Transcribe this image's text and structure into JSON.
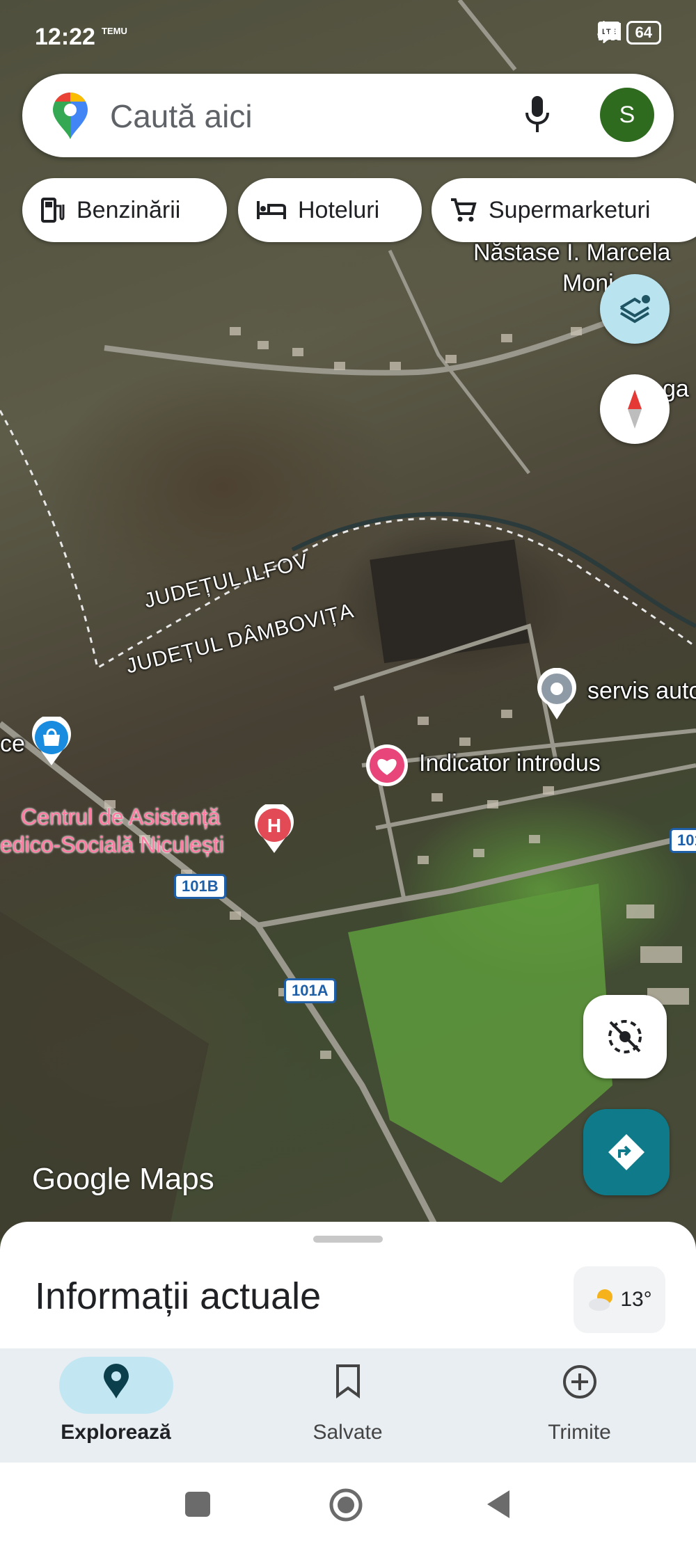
{
  "status_bar": {
    "time": "12:22",
    "carrier_badge": "TEMU",
    "network": "4G",
    "battery": "64"
  },
  "search": {
    "placeholder": "Caută aici",
    "avatar_initial": "S"
  },
  "chips": [
    {
      "label": "Benzinării",
      "icon": "gas-station-icon"
    },
    {
      "label": "Hoteluri",
      "icon": "bed-icon"
    },
    {
      "label": "Supermarketuri",
      "icon": "shopping-cart-icon"
    }
  ],
  "map": {
    "place_labels": {
      "nastase": "Năstase I. Marcela",
      "moni": "Moni",
      "gaga": "ga",
      "servis": "servis auto",
      "indicator": "Indicator introdus",
      "centrul_line1": "Centrul de Asistență",
      "centrul_line2": "edico-Socială Niculești",
      "ce": "ce"
    },
    "county_labels": {
      "ilfov": "JUDEȚUL ILFOV",
      "dambovita": "JUDEȚUL DÂMBOVIȚA"
    },
    "road_shields": [
      "101B",
      "101A",
      "101"
    ],
    "watermark": "Google Maps"
  },
  "sheet": {
    "title": "Informații actuale",
    "temperature": "13°",
    "weather_icon": "partly-sunny-icon"
  },
  "bottom_nav": [
    {
      "label": "Explorează",
      "icon": "location-pin-icon",
      "active": true
    },
    {
      "label": "Salvate",
      "icon": "bookmark-icon",
      "active": false
    },
    {
      "label": "Trimite",
      "icon": "add-circle-icon",
      "active": false
    }
  ],
  "colors": {
    "directions_fab": "#0f7b8a",
    "layers_fab": "#b9e3ef",
    "active_nav_pill": "#c2e7f3",
    "avatar": "#2e6b1f",
    "pink_label": "#ff7aa0",
    "shield_blue": "#1f5fa8"
  }
}
